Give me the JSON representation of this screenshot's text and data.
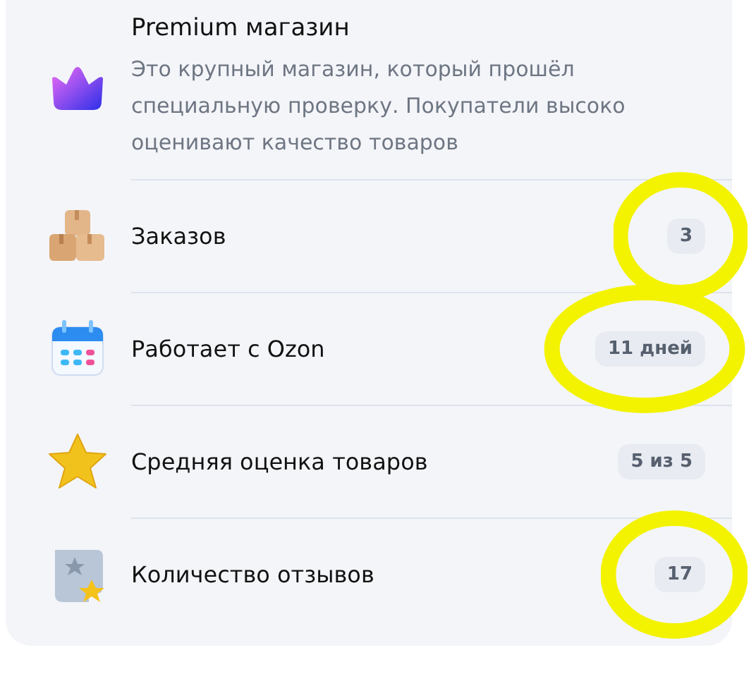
{
  "header": {
    "title": "Premium магазин",
    "description": "Это крупный магазин, который прошёл специальную проверку. Покупатели высоко оценивают качество товаров"
  },
  "rows": [
    {
      "kind": "boxes",
      "label": "Заказов",
      "value": "3",
      "circled": true
    },
    {
      "kind": "calendar",
      "label": "Работает с Ozon",
      "value": "11 дней",
      "circled": true
    },
    {
      "kind": "star",
      "label": "Средняя оценка товаров",
      "value": "5 из 5",
      "circled": false
    },
    {
      "kind": "reviews",
      "label": "Количество отзывов",
      "value": "17",
      "circled": true
    }
  ]
}
